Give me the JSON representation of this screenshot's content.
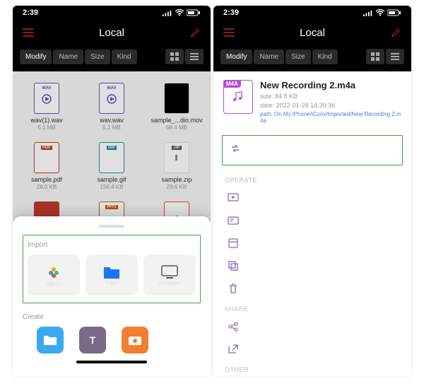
{
  "status": {
    "time": "2:39"
  },
  "header": {
    "title_left": "Local",
    "title_right": "Local"
  },
  "tabs": {
    "items": [
      "Modify",
      "Name",
      "Size",
      "Kind"
    ]
  },
  "files": [
    {
      "name": "wav(1).wav",
      "size": "5.1 MB",
      "tag": "WAV",
      "color": "#6a4fb7",
      "kind": "audio"
    },
    {
      "name": "wav.wav",
      "size": "5.1 MB",
      "tag": "WAV",
      "color": "#6a4fb7",
      "kind": "audio"
    },
    {
      "name": "sample_...dio.mov",
      "size": "68.4 MB",
      "tag": "",
      "color": "#000",
      "kind": "video"
    },
    {
      "name": "sample.pdf",
      "size": "28.0 KB",
      "tag": "PDF",
      "color": "#c0392b",
      "kind": "pdf"
    },
    {
      "name": "sample.gif",
      "size": "156.4 KB",
      "tag": "GIF",
      "color": "#2e8b8b",
      "kind": "gif"
    },
    {
      "name": "sample.zip",
      "size": "29.6 KB",
      "tag": "ZIP",
      "color": "#555",
      "kind": "zip"
    }
  ],
  "sheet": {
    "import_label": "Import",
    "create_label": "Create",
    "import_items": [
      "Album",
      "Files",
      "Computer"
    ]
  },
  "detail": {
    "name": "New Recording 2.m4a",
    "size_label": "size:",
    "size": "84.8 KB",
    "date_label": "date:",
    "date": "2022-01-28 14:39:36",
    "path_label": "path:",
    "path": "On My iPhone/iConv/Imported/New Recording 2.m4a",
    "icon_tag": "M4A"
  },
  "sections": {
    "operate": "OPERATE",
    "share": "SHARE",
    "other": "OTHER"
  }
}
